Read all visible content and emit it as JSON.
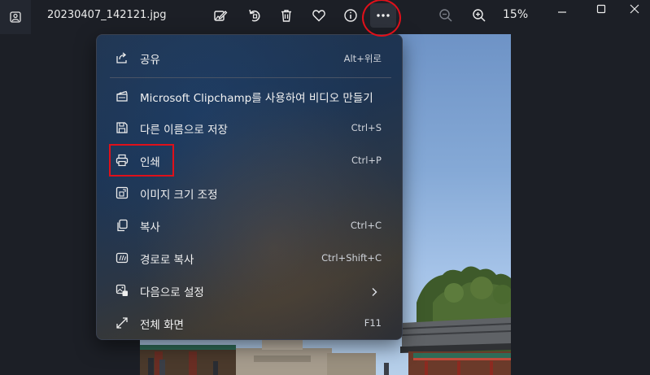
{
  "file_name": "20230407_142121.jpg",
  "zoom_level": "15%",
  "toolbar": {
    "icons": [
      "edit-image-icon",
      "rotate-icon",
      "delete-icon",
      "favorite-icon",
      "info-icon",
      "more-options-icon",
      "zoom-out-icon",
      "zoom-in-icon"
    ]
  },
  "menu": {
    "items": [
      {
        "label": "공유",
        "shortcut": "Alt+위로",
        "icon": "share-icon"
      },
      {
        "label": "Microsoft Clipchamp를 사용하여 비디오 만들기",
        "shortcut": "",
        "icon": "clipchamp-icon"
      },
      {
        "label": "다른 이름으로 저장",
        "shortcut": "Ctrl+S",
        "icon": "save-icon"
      },
      {
        "label": "인쇄",
        "shortcut": "Ctrl+P",
        "icon": "print-icon"
      },
      {
        "label": "이미지 크기 조정",
        "shortcut": "",
        "icon": "resize-icon"
      },
      {
        "label": "복사",
        "shortcut": "Ctrl+C",
        "icon": "copy-icon"
      },
      {
        "label": "경로로 복사",
        "shortcut": "Ctrl+Shift+C",
        "icon": "copy-path-icon"
      },
      {
        "label": "다음으로 설정",
        "shortcut": "",
        "icon": "set-as-icon"
      },
      {
        "label": "전체 화면",
        "shortcut": "F11",
        "icon": "fullscreen-icon"
      }
    ]
  },
  "colors": {
    "highlight": "#e0101a",
    "background": "#1c1f26"
  }
}
